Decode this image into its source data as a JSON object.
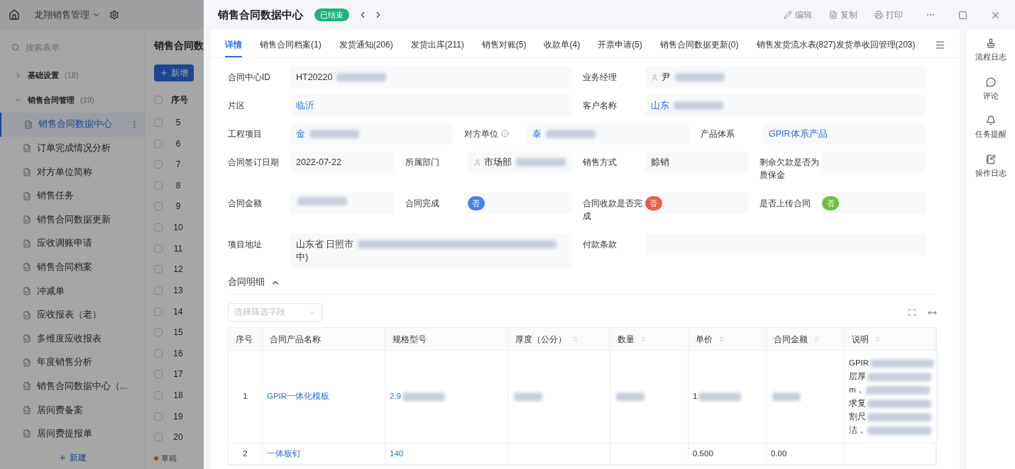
{
  "app": {
    "title": "龙翔销售管理",
    "search_placeholder": "搜索表单",
    "groups": [
      {
        "label": "基础设置",
        "count": "(18)",
        "expanded": false
      },
      {
        "label": "销售合同管理",
        "count": "(19)",
        "expanded": true,
        "children": [
          {
            "label": "销售合同数据中心",
            "selected": true
          },
          {
            "label": "订单完成情况分析",
            "selected": false
          },
          {
            "label": "对方单位简称",
            "selected": false
          },
          {
            "label": "销售任务",
            "selected": false
          },
          {
            "label": "销售合同数据更新",
            "selected": false
          },
          {
            "label": "应收调账申请",
            "selected": false
          },
          {
            "label": "销售合同档案",
            "selected": false
          },
          {
            "label": "冲减单",
            "selected": false
          },
          {
            "label": "应收报表（老）",
            "selected": false
          },
          {
            "label": "多维度应收报表",
            "selected": false
          },
          {
            "label": "年度销售分析",
            "selected": false
          },
          {
            "label": "销售合同数据中心（...",
            "selected": false
          },
          {
            "label": "居间费备案",
            "selected": false
          },
          {
            "label": "居间费提报单",
            "selected": false
          }
        ]
      }
    ],
    "new_form": "新建",
    "list_title": "销售合同数",
    "add_button": "新增",
    "list_header": "序号",
    "header_checked": false,
    "list_rows": [
      {
        "number": "5",
        "checked": false
      },
      {
        "number": "6",
        "checked": false
      },
      {
        "number": "7",
        "checked": false
      },
      {
        "number": "8",
        "checked": false
      },
      {
        "number": "9",
        "checked": false
      },
      {
        "number": "10",
        "checked": false
      },
      {
        "number": "11",
        "checked": false
      },
      {
        "number": "12",
        "checked": false
      },
      {
        "number": "13",
        "checked": false
      },
      {
        "number": "14",
        "checked": false
      },
      {
        "number": "15",
        "checked": false
      },
      {
        "number": "16",
        "checked": false
      },
      {
        "number": "17",
        "checked": false
      },
      {
        "number": "18",
        "checked": false
      },
      {
        "number": "19",
        "checked": false
      },
      {
        "number": "20",
        "checked": false
      }
    ],
    "draft": "草稿"
  },
  "drawer": {
    "title": "销售合同数据中心",
    "status": "已结束",
    "actions": [
      {
        "kind": "edit",
        "label": "编辑"
      },
      {
        "kind": "copy",
        "label": "复制"
      },
      {
        "kind": "print",
        "label": "打印"
      }
    ],
    "tabs": [
      {
        "label": "详情",
        "selected": true
      },
      {
        "label": "销售合同档案(1)",
        "selected": false
      },
      {
        "label": "发货通知(206)",
        "selected": false
      },
      {
        "label": "发货出库(211)",
        "selected": false
      },
      {
        "label": "销售对账(5)",
        "selected": false
      },
      {
        "label": "收款单(4)",
        "selected": false
      },
      {
        "label": "开票申请(5)",
        "selected": false
      },
      {
        "label": "销售合同数据更新(0)",
        "selected": false
      },
      {
        "label": "销售发货流水表(827)",
        "selected": false
      },
      {
        "label": "发货单收回管理(203)",
        "selected": false
      }
    ],
    "form_rows": [
      [
        {
          "label": "合同中心ID",
          "kind": "text",
          "value": "HT20220",
          "redacted": true
        },
        {
          "label": "业务经理",
          "kind": "user",
          "value": "尹",
          "redacted": true
        }
      ],
      [
        {
          "label": "片区",
          "kind": "link",
          "value": "临沂"
        },
        {
          "label": "客户名称",
          "kind": "link",
          "value": "山东",
          "redacted": true
        }
      ],
      [
        {
          "label": "工程项目",
          "kind": "link",
          "value": "金",
          "redacted": true
        },
        {
          "label": "对方单位",
          "info": true,
          "kind": "link",
          "value": "泰",
          "redacted": true
        },
        {
          "label": "产品体系",
          "kind": "link",
          "value": "GPIR体系产品"
        }
      ],
      [
        {
          "label": "合同签订日期",
          "kind": "text",
          "value": "2022-07-22"
        },
        {
          "label": "所属部门",
          "kind": "user",
          "value": "市场部",
          "redacted": true
        },
        {
          "label": "销售方式",
          "kind": "text",
          "value": "赊销"
        },
        {
          "label": "剩余欠款是否为质保金",
          "kind": "empty"
        }
      ],
      [
        {
          "label": "合同金额",
          "kind": "text",
          "redacted": true
        },
        {
          "label": "合同完成",
          "kind": "badge",
          "value": "否",
          "color": "#4a7ff0"
        },
        {
          "label": "合同收款是否完成",
          "kind": "badge",
          "value": "否",
          "color": "#ee5a4b"
        },
        {
          "label": "是否上传合同",
          "kind": "badge",
          "value": "否",
          "color": "#6cbf3a"
        }
      ],
      [
        {
          "label": "项目地址",
          "kind": "text",
          "value": "山东省 日照市",
          "redacted": true,
          "value_2": "中)"
        },
        {
          "label": "付款条款",
          "kind": "empty"
        }
      ]
    ],
    "detail": {
      "title": "合同明细",
      "expanded": true,
      "filter_placeholder": "选择筛选字段",
      "columns": [
        {
          "label": "序号",
          "sortable": false
        },
        {
          "label": "合同产品名称",
          "sortable": false
        },
        {
          "label": "规格型号",
          "sortable": false
        },
        {
          "label": "厚度（公分）",
          "sortable": true
        },
        {
          "label": "数量",
          "sortable": true
        },
        {
          "label": "单价",
          "sortable": true
        },
        {
          "label": "合同金额",
          "sortable": true
        },
        {
          "label": "说明",
          "sortable": true
        }
      ],
      "rows": [
        [
          {
            "text": "1"
          },
          {
            "text": "GPIR一体化模板",
            "link": true
          },
          {
            "text": "2.9",
            "redacted": true,
            "link": true
          },
          {
            "redacted": true
          },
          {
            "redacted": true
          },
          {
            "text": "1",
            "redacted": true
          },
          {
            "redacted": true
          },
          {
            "lines": [
              "GPIR",
              "层厚",
              "m，",
              "求复",
              "割尺",
              "洁，"
            ],
            "redacted": true
          }
        ],
        [
          {
            "text": "2"
          },
          {
            "text": "一体板钉",
            "link": true
          },
          {
            "text": "140",
            "link": true
          },
          {},
          {},
          {
            "text": "0.500"
          },
          {
            "text": "0.00"
          },
          {}
        ]
      ]
    },
    "rail": [
      {
        "kind": "flow",
        "label": "流程日志"
      },
      {
        "kind": "comment",
        "label": "评论"
      },
      {
        "kind": "reminder",
        "label": "任务提醒"
      },
      {
        "kind": "log",
        "label": "操作日志"
      }
    ]
  }
}
